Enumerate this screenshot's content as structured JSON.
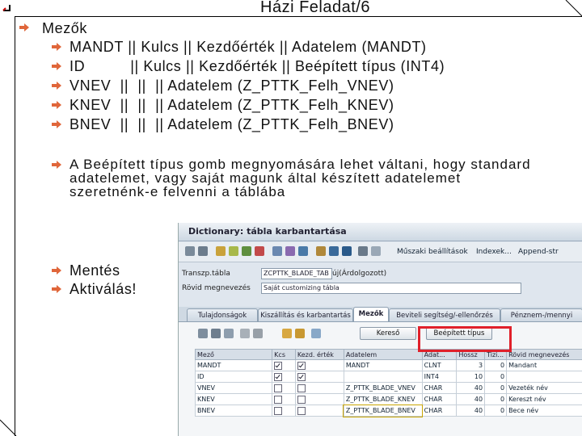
{
  "slide": {
    "title": "Házi Feladat/6",
    "heading": "Mezők",
    "fields": [
      "MANDT || Kulcs || Kezdőérték || Adatelem (MANDT)",
      "ID          || Kulcs || Kezdőérték || Beépített típus (INT4)",
      "VNEV  ||  ||  || Adatelem (Z_PTTK_Felh_VNEV)",
      "KNEV  ||  ||  || Adatelem (Z_PTTK_Felh_KNEV)",
      "BNEV  ||  ||  || Adatelem (Z_PTTK_Felh_BNEV)"
    ],
    "paragraph": "A Beépített típus gomb megnyomására lehet váltani, hogy standard adatelemet, vagy saját magunk által készített adatelemet szeretnénk-e felvenni a táblába",
    "steps": [
      "Mentés",
      "Aktiválás!"
    ],
    "colors": {
      "arrow": "#e0663a",
      "highlight": "#e0202a"
    }
  },
  "sap": {
    "window_title": "Dictionary: tábla karbantartása",
    "toolbar": {
      "tech_settings": "Műszaki beállítások",
      "indexes": "Indexek...",
      "append": "Append-str"
    },
    "fields": {
      "table_label": "Transzp.tábla",
      "table_value": "ZCPTTK_BLADE_TAB",
      "status_text": "új(Árdolgozott)",
      "short_label": "Rövid megnevezés",
      "short_value": "Saját customizing tábla"
    },
    "tabs": [
      "Tulajdonságok",
      "Kiszállítás és karbantartás",
      "Mezők",
      "Beviteli segítség/-ellenőrzés",
      "Pénznem-/mennyi"
    ],
    "buttons": {
      "search_help": "Kereső",
      "builtin_type": "Beépített típus"
    },
    "columns": [
      "Mező",
      "Kcs",
      "Kezd. érték",
      "Adatelem",
      "Adat...",
      "Hossz",
      "Tizi...",
      "Rövid megnevezés"
    ],
    "rows": [
      {
        "field": "MANDT",
        "key": true,
        "init": true,
        "element": "MANDT",
        "type": "CLNT",
        "length": "3",
        "dec": "0",
        "desc": "Mandant"
      },
      {
        "field": "ID",
        "key": true,
        "init": true,
        "element": "",
        "type": "INT4",
        "length": "10",
        "dec": "0",
        "desc": ""
      },
      {
        "field": "VNEV",
        "key": false,
        "init": false,
        "element": "Z_PTTK_BLADE_VNEV",
        "type": "CHAR",
        "length": "40",
        "dec": "0",
        "desc": "Vezeték név"
      },
      {
        "field": "KNEV",
        "key": false,
        "init": false,
        "element": "Z_PTTK_BLADE_KNEV",
        "type": "CHAR",
        "length": "40",
        "dec": "0",
        "desc": "Kereszt név"
      },
      {
        "field": "BNEV",
        "key": false,
        "init": false,
        "element": "Z_PTTK_BLADE_BNEV",
        "type": "CHAR",
        "length": "40",
        "dec": "0",
        "desc": "Bece név"
      }
    ]
  }
}
